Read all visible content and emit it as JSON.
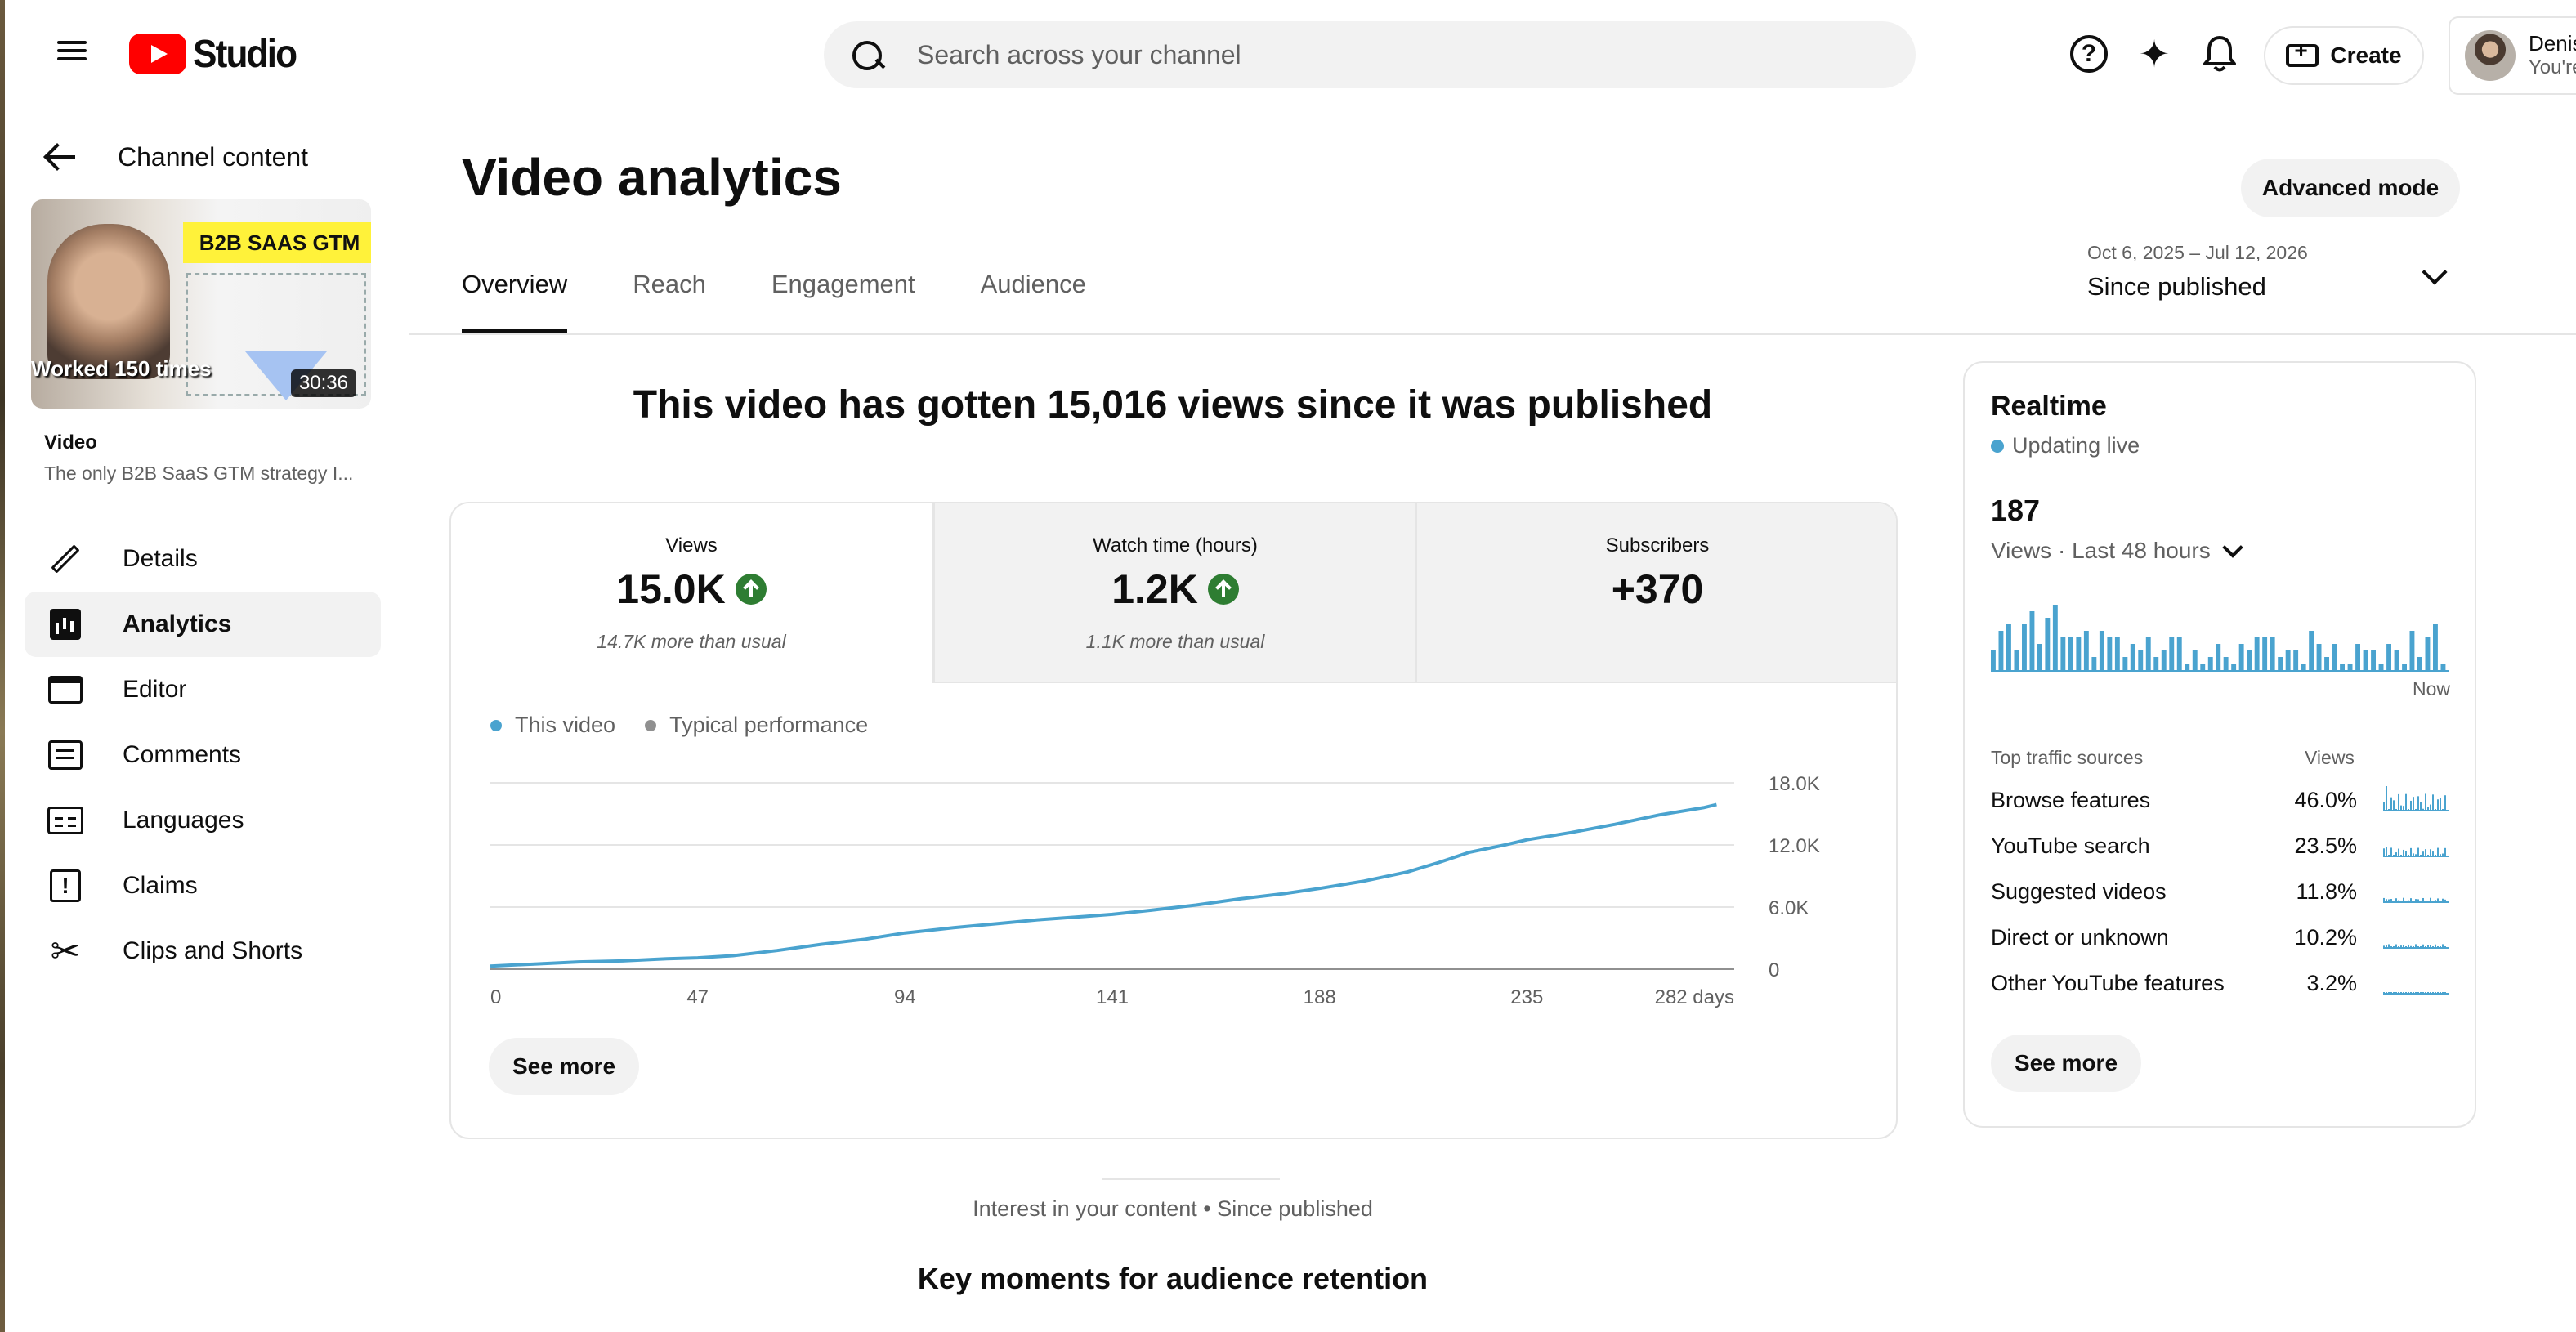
{
  "header": {
    "logo_text": "Studio",
    "search_placeholder": "Search across your channel",
    "create_label": "Create",
    "account_name": "Denis",
    "account_sub": "You're"
  },
  "sidebar": {
    "back_label": "Channel content",
    "thumbnail": {
      "tag": "B2B SAAS GTM",
      "caption": "Worked 150 times",
      "duration": "30:36"
    },
    "video_label": "Video",
    "video_title": "The only B2B SaaS GTM strategy I...",
    "items": [
      {
        "label": "Details",
        "icon": "pencil-icon",
        "active": false
      },
      {
        "label": "Analytics",
        "icon": "analytics-icon",
        "active": true
      },
      {
        "label": "Editor",
        "icon": "editor-icon",
        "active": false
      },
      {
        "label": "Comments",
        "icon": "comments-icon",
        "active": false
      },
      {
        "label": "Languages",
        "icon": "languages-icon",
        "active": false
      },
      {
        "label": "Claims",
        "icon": "claims-icon",
        "active": false
      },
      {
        "label": "Clips and Shorts",
        "icon": "scissors-icon",
        "active": false
      }
    ]
  },
  "main": {
    "title": "Video analytics",
    "advanced_mode_label": "Advanced mode",
    "tabs": [
      {
        "label": "Overview",
        "active": true
      },
      {
        "label": "Reach",
        "active": false
      },
      {
        "label": "Engagement",
        "active": false
      },
      {
        "label": "Audience",
        "active": false
      }
    ],
    "date_range": {
      "dates": "Oct 6, 2025 – Jul 12, 2026",
      "label": "Since published"
    },
    "headline": "This video has gotten 15,016 views since it was published",
    "metrics": [
      {
        "label": "Views",
        "value": "15.0K",
        "trend": "up",
        "note": "14.7K more than usual",
        "selected": true
      },
      {
        "label": "Watch time (hours)",
        "value": "1.2K",
        "trend": "up",
        "note": "1.1K more than usual",
        "selected": false
      },
      {
        "label": "Subscribers",
        "value": "+370",
        "trend": "",
        "note": "",
        "selected": false
      }
    ],
    "see_more_label": "See more",
    "interest_text": "Interest in your content • Since published",
    "key_moments_title": "Key moments for audience retention"
  },
  "colors": {
    "series": "#4aa3cf",
    "typical": "#909090",
    "up": "#2e7d32",
    "brand_red": "#ff0000"
  },
  "chart_data": [
    {
      "type": "line",
      "legend": [
        "This video",
        "Typical performance"
      ],
      "x_ticks": [
        "0",
        "47",
        "94",
        "141",
        "188",
        "235",
        "282 days"
      ],
      "y_ticks": [
        "0",
        "6.0K",
        "12.0K",
        "18.0K"
      ],
      "xlim": [
        0,
        282
      ],
      "ylim": [
        0,
        18000
      ],
      "series": [
        {
          "name": "This video",
          "x": [
            0,
            10,
            20,
            30,
            40,
            47,
            55,
            65,
            75,
            85,
            94,
            105,
            115,
            125,
            135,
            141,
            150,
            160,
            170,
            180,
            188,
            198,
            208,
            215,
            222,
            230,
            235,
            245,
            255,
            265,
            275,
            278
          ],
          "y": [
            300,
            500,
            700,
            800,
            1000,
            1100,
            1300,
            1800,
            2400,
            2900,
            3500,
            4000,
            4400,
            4800,
            5100,
            5300,
            5700,
            6200,
            6800,
            7300,
            7800,
            8500,
            9400,
            10300,
            11300,
            12000,
            12500,
            13200,
            14000,
            14900,
            15600,
            15900
          ]
        }
      ],
      "grid": true
    },
    {
      "type": "bar",
      "title": "Realtime",
      "subtitle": "Updating live",
      "total": "187",
      "period": "Views · Last 48 hours",
      "x_end_label": "Now",
      "values": [
        3,
        6,
        7,
        3,
        7,
        9,
        4,
        8,
        10,
        5,
        5,
        5,
        6,
        2,
        6,
        5,
        5,
        2,
        4,
        3,
        5,
        2,
        3,
        5,
        5,
        1,
        3,
        1,
        2,
        4,
        2,
        1,
        4,
        3,
        5,
        5,
        5,
        2,
        3,
        3,
        1,
        6,
        4,
        2,
        4,
        1,
        1,
        4,
        3,
        3,
        1,
        4,
        3,
        1,
        6,
        2,
        5,
        7,
        1
      ]
    }
  ],
  "realtime": {
    "title": "Realtime",
    "live_label": "Updating live",
    "count": "187",
    "period_label": "Views · Last 48 hours",
    "now_label": "Now",
    "table_header": {
      "source": "Top traffic sources",
      "views": "Views"
    },
    "sources": [
      {
        "name": "Browse features",
        "pct": "46.0%"
      },
      {
        "name": "YouTube search",
        "pct": "23.5%"
      },
      {
        "name": "Suggested videos",
        "pct": "11.8%"
      },
      {
        "name": "Direct or unknown",
        "pct": "10.2%"
      },
      {
        "name": "Other YouTube features",
        "pct": "3.2%"
      }
    ],
    "see_more_label": "See more"
  }
}
